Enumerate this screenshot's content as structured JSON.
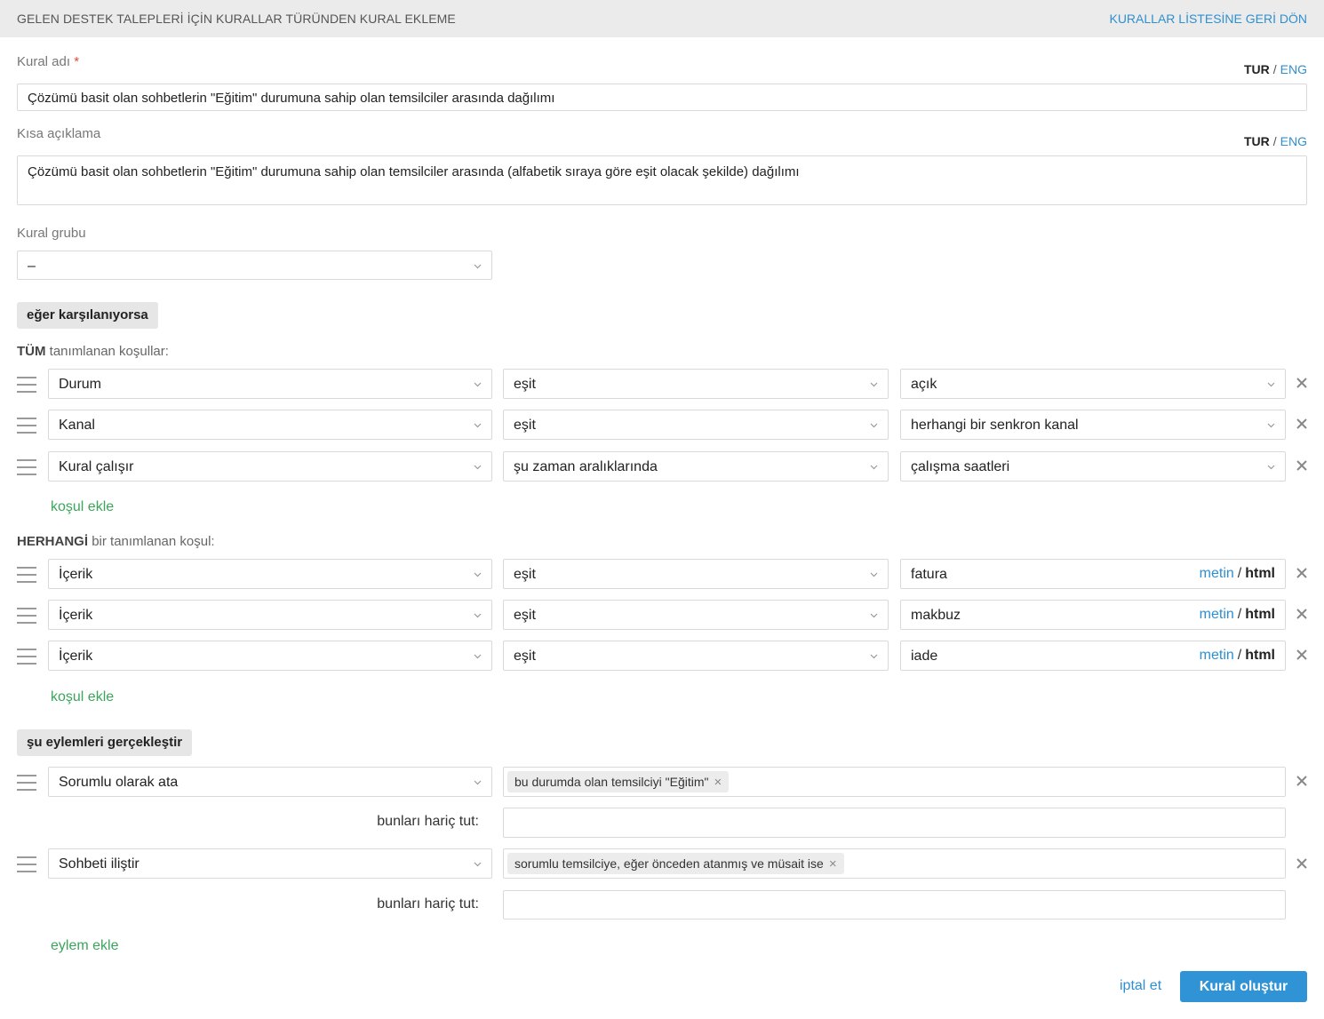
{
  "header": {
    "title": "GELEN DESTEK TALEPLERİ İÇİN KURALLAR TÜRÜNDEN KURAL EKLEME",
    "back_link": "KURALLAR LİSTESİNE GERİ DÖN"
  },
  "lang_switch": {
    "active": "TUR",
    "separator": "/",
    "inactive": "ENG"
  },
  "rule_name": {
    "label": "Kural adı",
    "required_mark": "*",
    "value": "Çözümü basit olan sohbetlerin \"Eğitim\" durumuna sahip olan temsilciler arasında dağılımı"
  },
  "short_description": {
    "label": "Kısa açıklama",
    "value": "Çözümü basit olan sohbetlerin \"Eğitim\" durumuna sahip olan temsilciler arasında (alfabetik sıraya göre eşit olacak şekilde) dağılımı"
  },
  "rule_group": {
    "label": "Kural grubu",
    "value": "–"
  },
  "conditions_section": {
    "tag": "eğer karşılanıyorsa",
    "all": {
      "caption_bold": "TÜM",
      "caption_rest": "tanımlanan koşullar:",
      "rows": [
        {
          "field": "Durum",
          "operator": "eşit",
          "value": "açık"
        },
        {
          "field": "Kanal",
          "operator": "eşit",
          "value": "herhangi bir senkron kanal"
        },
        {
          "field": "Kural çalışır",
          "operator": "şu zaman aralıklarında",
          "value": "çalışma saatleri"
        }
      ],
      "add_label": "koşul ekle"
    },
    "any": {
      "caption_bold": "HERHANGİ",
      "caption_rest": "bir tanımlanan koşul:",
      "rows": [
        {
          "field": "İçerik",
          "operator": "eşit",
          "value": "fatura"
        },
        {
          "field": "İçerik",
          "operator": "eşit",
          "value": "makbuz"
        },
        {
          "field": "İçerik",
          "operator": "eşit",
          "value": "iade"
        }
      ],
      "format_text": "metin",
      "format_sep": "/",
      "format_html": "html",
      "add_label": "koşul ekle"
    }
  },
  "actions_section": {
    "tag": "şu eylemleri gerçekleştir",
    "actions": [
      {
        "action": "Sorumlu olarak ata",
        "tag": "bu durumda olan temsilciyi \"Eğitim\"",
        "exclude_label": "bunları hariç tut:",
        "exclude_value": ""
      },
      {
        "action": "Sohbeti iliştir",
        "tag": "sorumlu temsilciye, eğer önceden atanmış ve müsait ise",
        "exclude_label": "bunları hariç tut:",
        "exclude_value": ""
      }
    ],
    "add_label": "eylem ekle"
  },
  "footer": {
    "cancel": "iptal et",
    "submit": "Kural oluştur"
  },
  "colors": {
    "accent": "#2f93d6",
    "link": "#2f8fd0",
    "green": "#3aa55b",
    "required": "#e5483b"
  },
  "icons": [
    "chevron-down-icon",
    "drag-handle-icon",
    "close-icon",
    "tag-remove-icon"
  ]
}
